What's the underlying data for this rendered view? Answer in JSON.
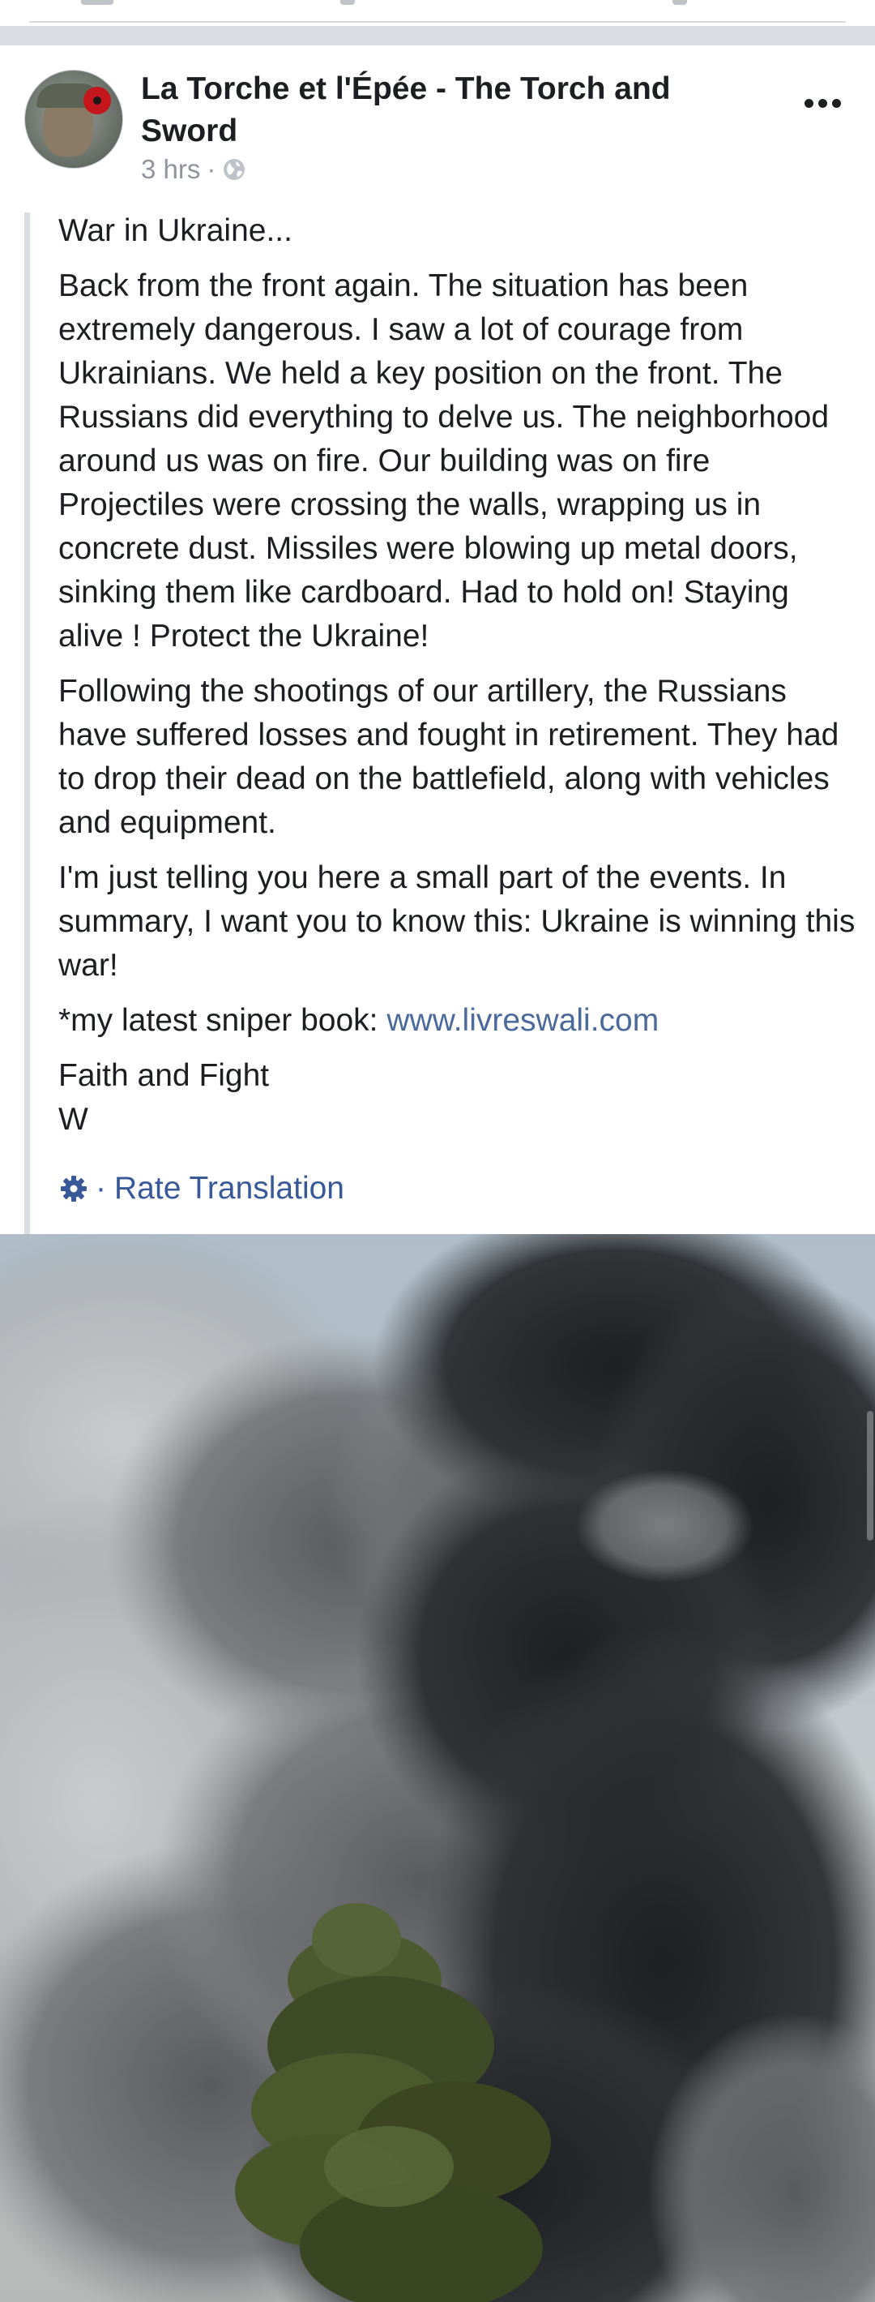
{
  "post": {
    "page_name": "La Torche et l'Épée - The Torch and Sword",
    "time": "3 hrs",
    "meta_separator": "·",
    "privacy_icon": "globe-icon",
    "more_icon": "more-horizontal-icon",
    "paragraphs": [
      "War in Ukraine...",
      "Back from the front again. The situation has been extremely dangerous. I saw a lot of courage from Ukrainians. We held a key position on the front. The Russians did everything to delve us. The neighborhood around us was on fire. Our building was on fire Projectiles were crossing the walls, wrapping us in concrete dust. Missiles were blowing up metal doors, sinking them like cardboard. Had to hold on! Staying alive ! Protect the Ukraine!",
      "Following the shootings of our artillery, the Russians have suffered losses and fought in retirement. They had to drop their dead on the battlefield, along with vehicles and equipment.",
      "I'm just telling you here a small part of the events. In summary, I want you to know this: Ukraine is winning this war!"
    ],
    "book_prefix": "*my latest sniper book: ",
    "book_link": "www.livreswali.com",
    "signoff_line1": "Faith and Fight",
    "signoff_line2": "W",
    "rate_separator": "·",
    "rate_translation": "Rate Translation",
    "photo_icon": "smoke-photo"
  },
  "colors": {
    "link": "#4b6a9b",
    "action_blue": "#385898",
    "meta_gray": "#90949c",
    "separator": "#dadde1"
  }
}
